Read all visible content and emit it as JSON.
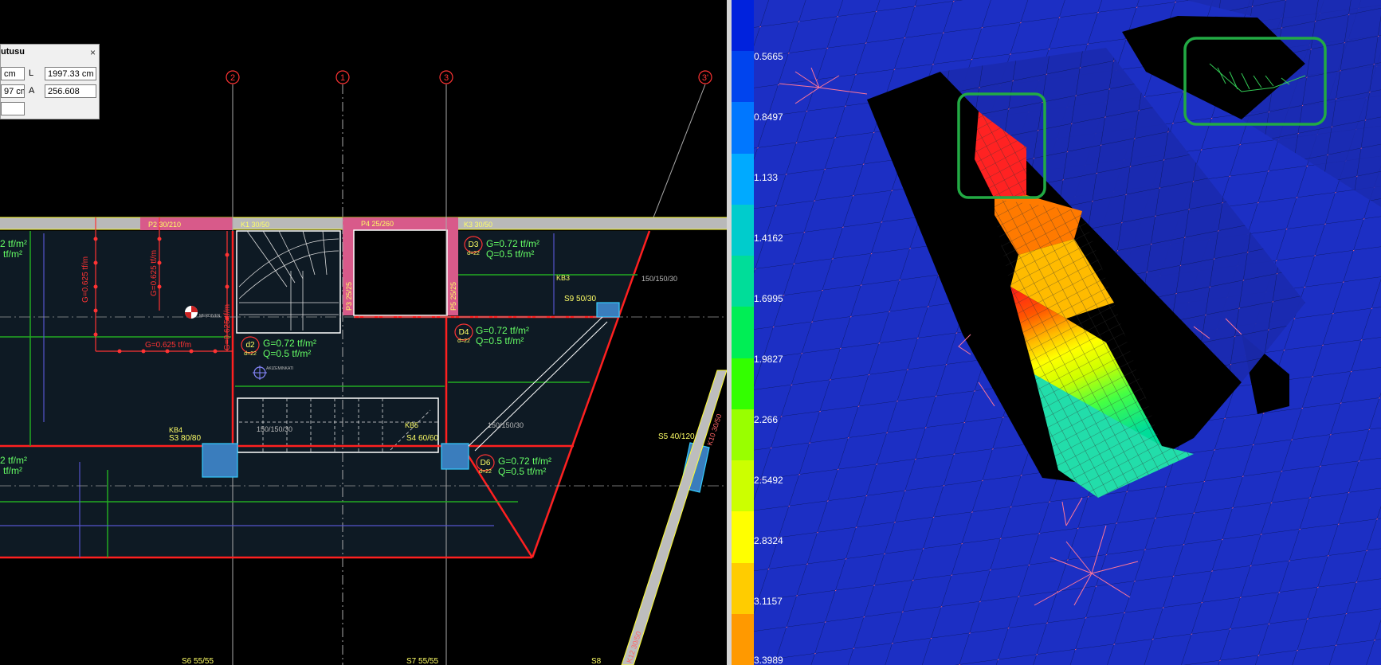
{
  "info_box": {
    "title": "utusu",
    "close": "×",
    "field1_value": "cm",
    "field2_value": "97 cm",
    "label_L": "L",
    "label_A": "A",
    "L_value": "1997.33 cm",
    "A_value": "256.608"
  },
  "axes": [
    "2",
    "1",
    "3",
    "3'"
  ],
  "beams": {
    "p2": "P2 30/210",
    "k1": "K1 30/50",
    "p4": "P4 25/260",
    "k3": "K3 30/50",
    "p3": "P3 25/25",
    "p5": "P5 25/25",
    "kb3": "KB3",
    "s9": "S9 50/30",
    "p_150": "150/150/30",
    "kb4": "KB4",
    "s3": "S3 80/80",
    "kb5": "KB5",
    "s4": "S4 60/60",
    "p_150b": "150/150/30",
    "p_150c": "150/150/30",
    "s5": "S5 40/120",
    "k10": "K10 30/50",
    "s6": "S6 55/55",
    "s7": "S7 55/55",
    "s8": "S8",
    "k_bottom": "K12 30/50"
  },
  "line_loads": {
    "g1": "G=0.625 tf/m",
    "g2": "G=0.625 tf/m",
    "g3": "G=0.625 tf/m",
    "g4": "G=0.625 tf/m"
  },
  "slabs": {
    "d3": {
      "tag": "D3",
      "d": "d=22",
      "g": "G=0.72  tf/m²",
      "q": "Q=0.5  tf/m²"
    },
    "d4": {
      "tag": "D4",
      "d": "d=22",
      "g": "G=0.72  tf/m²",
      "q": "Q=0.5  tf/m²"
    },
    "d2": {
      "tag": "d2",
      "d": "d=22",
      "g": "G=0.72  tf/m²",
      "q": "Q=0.5  tf/m²"
    },
    "d6": {
      "tag": "D6",
      "d": "d=22",
      "g": "G=0.72  tf/m²",
      "q": "Q=0.5  tf/m²"
    },
    "left_top_g": "2  tf/m²",
    "left_top_q": "tf/m²",
    "left_bot_g": "2  tf/m²",
    "left_bot_q": "tf/m²"
  },
  "marker_text": "MERDIVEN",
  "mark_text": "AKIZEMINKATI",
  "legend": {
    "colors": [
      "#0022dd",
      "#0044ee",
      "#0077ff",
      "#00aaff",
      "#00cccc",
      "#00dd99",
      "#00ee55",
      "#33ff00",
      "#99ff00",
      "#ccff00",
      "#ffff00",
      "#ffcc00",
      "#ff9900"
    ],
    "values": [
      "0.5665",
      "0.8497",
      "1.133",
      "1.4162",
      "1.6995",
      "1.9827",
      "2.266",
      "2.5492",
      "2.8324",
      "3.1157",
      "3.3989"
    ]
  }
}
